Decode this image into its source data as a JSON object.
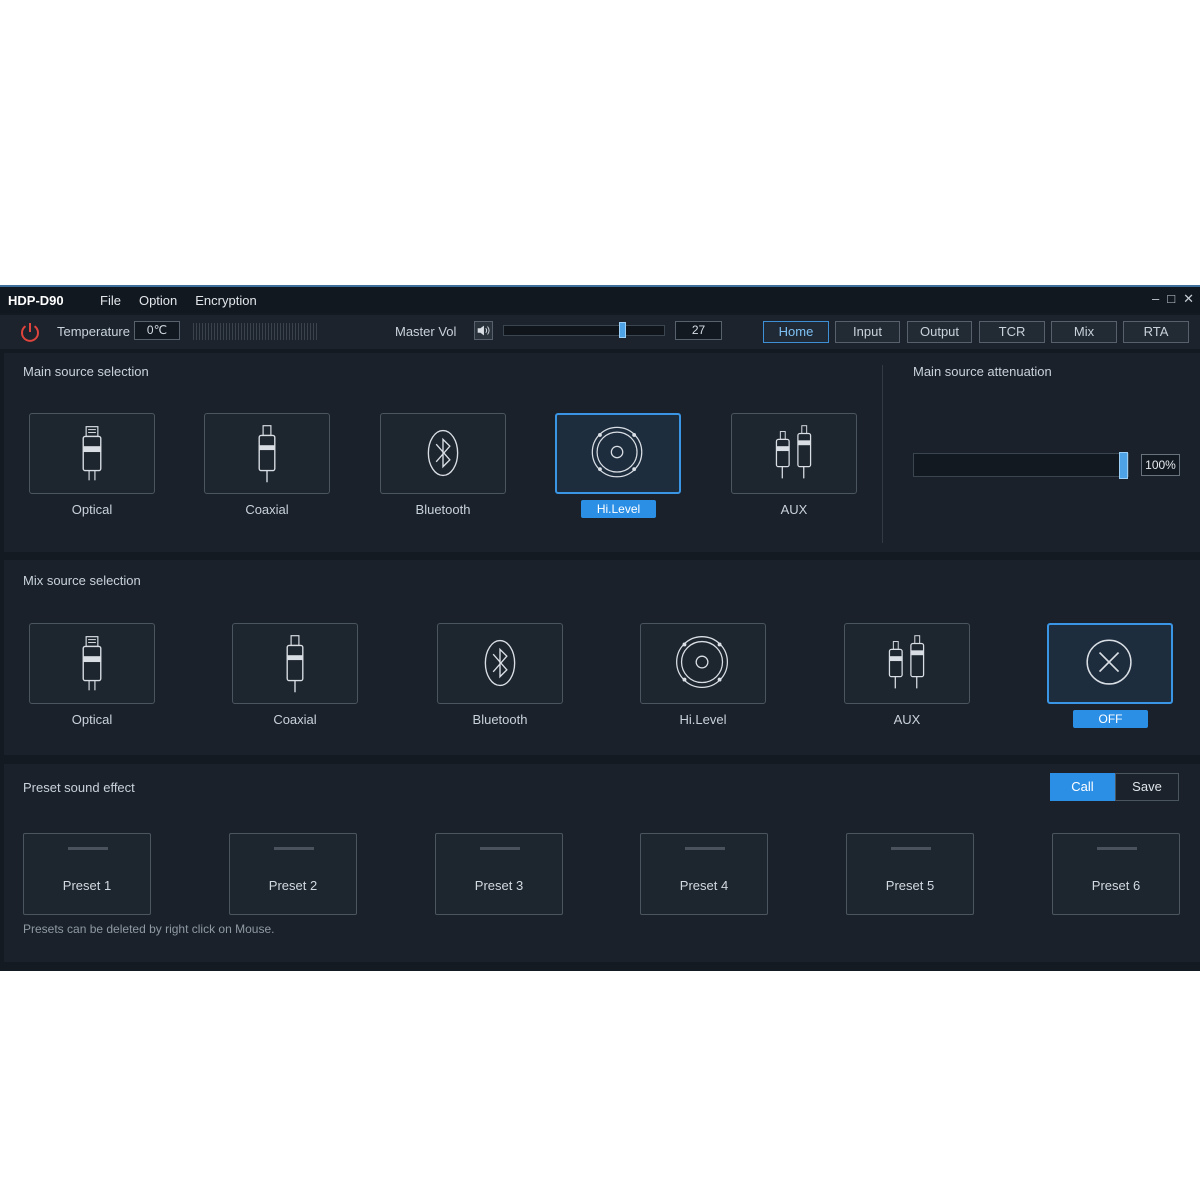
{
  "window": {
    "title": "HDP-D90",
    "menu": [
      "File",
      "Option",
      "Encryption"
    ],
    "controls": [
      "–",
      "□",
      "✕"
    ]
  },
  "toolbar": {
    "temperature_label": "Temperature",
    "temperature_value": "0℃",
    "master_vol_label": "Master Vol",
    "master_vol_value": "27",
    "master_vol_level": 0.75,
    "tabs": [
      "Home",
      "Input",
      "Output",
      "TCR",
      "Mix",
      "RTA"
    ],
    "active_tab": "Home"
  },
  "main_source": {
    "title": "Main source selection",
    "items": [
      "Optical",
      "Coaxial",
      "Bluetooth",
      "Hi.Level",
      "AUX"
    ],
    "selected": "Hi.Level"
  },
  "attenuation": {
    "title": "Main source attenuation",
    "value": "100%",
    "level": 1.0
  },
  "mix_source": {
    "title": "Mix  source selection",
    "items": [
      "Optical",
      "Coaxial",
      "Bluetooth",
      "Hi.Level",
      "AUX",
      "OFF"
    ],
    "selected": "OFF"
  },
  "preset": {
    "title": "Preset sound effect",
    "call_label": "Call",
    "save_label": "Save",
    "items": [
      "Preset 1",
      "Preset 2",
      "Preset 3",
      "Preset 4",
      "Preset 5",
      "Preset 6"
    ],
    "hint": "Presets can be deleted by right click on Mouse."
  },
  "colors": {
    "accent": "#2b8fe6",
    "background": "#131a22",
    "panel": "#1a212a",
    "power": "#e0443c"
  },
  "icons": {
    "optical": "optical-plug-icon",
    "coaxial": "coaxial-plug-icon",
    "bluetooth": "bluetooth-icon",
    "hilevel": "speaker-icon",
    "aux": "rca-plug-icon",
    "off": "close-circle-icon"
  }
}
